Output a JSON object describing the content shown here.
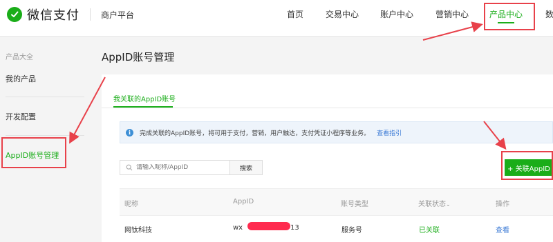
{
  "header": {
    "brand": "微信支付",
    "merchant_label": "商户平台",
    "nav": [
      "首页",
      "交易中心",
      "账户中心",
      "营销中心",
      "产品中心",
      "数"
    ],
    "active_nav": "产品中心"
  },
  "sidebar": {
    "group_label": "产品大全",
    "items": [
      {
        "label": "我的产品"
      },
      {
        "label": "开发配置"
      },
      {
        "label": "AppID账号管理"
      }
    ],
    "active_item": "AppID账号管理"
  },
  "main": {
    "title": "AppID账号管理",
    "tab": "我关联的AppID账号",
    "notice": {
      "text": "完成关联的AppID账号，将可用于支付，营销，用户触达，支付凭证小程序等业务。",
      "link": "查看指引"
    },
    "search": {
      "placeholder": "请输入昵称/AppID",
      "button": "搜索"
    },
    "add_button": "+ 关联AppID",
    "table": {
      "headers": [
        "昵称",
        "AppID",
        "账号类型",
        "关联状态",
        "操作"
      ],
      "sort_indicator": "⌄",
      "rows": [
        {
          "nickname": "网钛科技",
          "appid_prefix": "wx",
          "appid_suffix": "13",
          "type": "服务号",
          "status": "已关联",
          "action": "查看"
        }
      ]
    }
  },
  "colors": {
    "accent": "#1aad19",
    "link": "#3d7bd6",
    "annotation": "#e8414a",
    "redaction": "#ff2b4f"
  }
}
